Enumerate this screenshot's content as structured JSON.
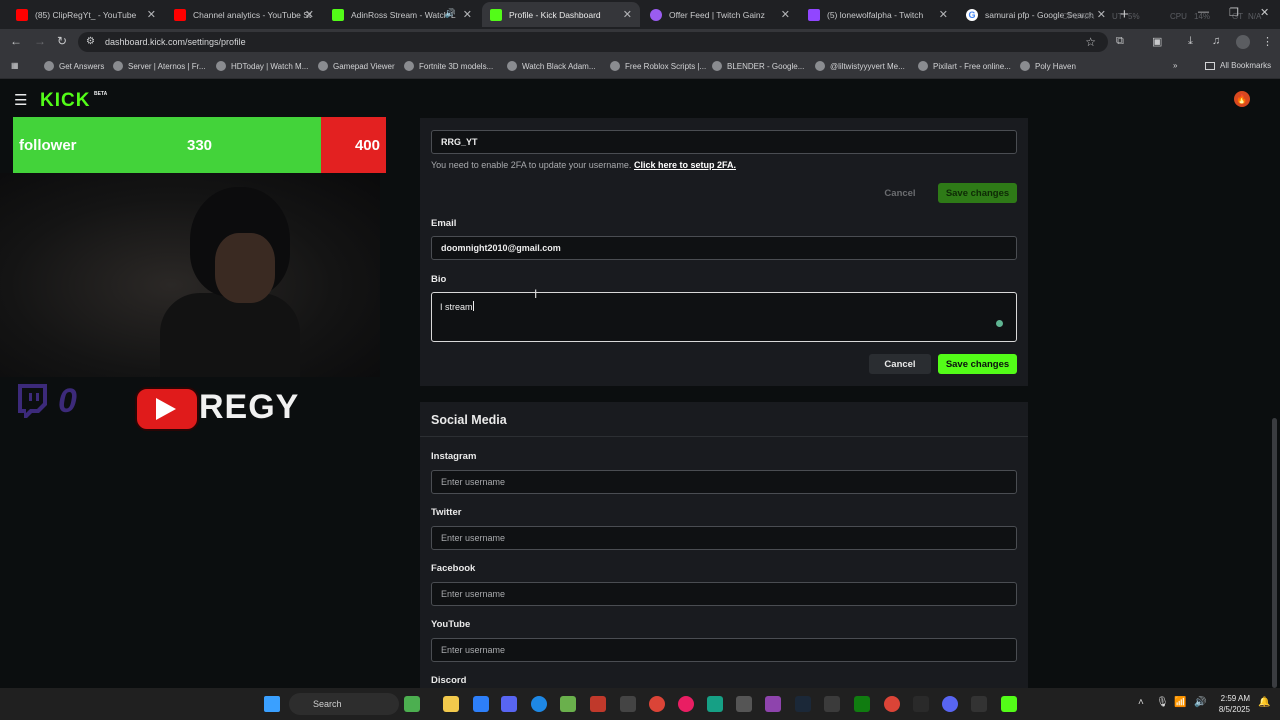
{
  "browser": {
    "tabs": [
      {
        "title": "(85) ClipRegYt_ - YouTube",
        "color": "#ff0000"
      },
      {
        "title": "Channel analytics - YouTube St",
        "color": "#ff0000"
      },
      {
        "title": "AdinRoss Stream - Watch L",
        "color": "#53fc18"
      },
      {
        "title": "Profile - Kick Dashboard",
        "color": "#53fc18"
      },
      {
        "title": "Offer Feed | Twitch Gainz",
        "color": "#9a5cf0"
      },
      {
        "title": "(5) lonewolfalpha - Twitch",
        "color": "#9146ff"
      },
      {
        "title": "samurai pfp - Google Search",
        "color": "#4285f4"
      }
    ],
    "url": "dashboard.kick.com/settings/profile",
    "bookmarks": [
      "Get Answers",
      "Server | Aternos | Fr...",
      "HDToday | Watch M...",
      "Gamepad Viewer",
      "Fortnite 3D models...",
      "Watch Black Adam...",
      "Free Roblox Scripts |...",
      "BLENDER - Google...",
      "@liltwistyyyvert Me...",
      "Pixilart - Free online...",
      "Poly Haven"
    ],
    "all_bookmarks": "All Bookmarks",
    "hw_stats": [
      "CPU",
      "N/A",
      "UT",
      "5%",
      "CPU",
      "14%",
      "GT",
      "N/A"
    ]
  },
  "stream_overlay": {
    "goal_type": "follower",
    "goal_current": "330",
    "goal_target": "400",
    "goal_progress": 0.825,
    "twitch_count": "0",
    "youtube_name": "REGY",
    "goal_fill_color": "#43d33a",
    "goal_bg_color": "#e32121"
  },
  "kick": {
    "logo": "KICK",
    "beta": "BETA",
    "accent": "#53fc18"
  },
  "profile": {
    "username": "RRG_YT",
    "twofa_note": "You need to enable 2FA to update your username.",
    "twofa_link": "Click here to setup 2FA.",
    "cancel_label": "Cancel",
    "save_label": "Save changes",
    "email_label": "Email",
    "email": "doomnight2010@gmail.com",
    "bio_label": "Bio",
    "bio": "I stream"
  },
  "social": {
    "title": "Social Media",
    "placeholder": "Enter username",
    "fields": [
      "Instagram",
      "Twitter",
      "Facebook",
      "YouTube",
      "Discord"
    ]
  },
  "taskbar": {
    "search": "Search",
    "time": "2:59 AM",
    "date": "8/5/2025"
  }
}
